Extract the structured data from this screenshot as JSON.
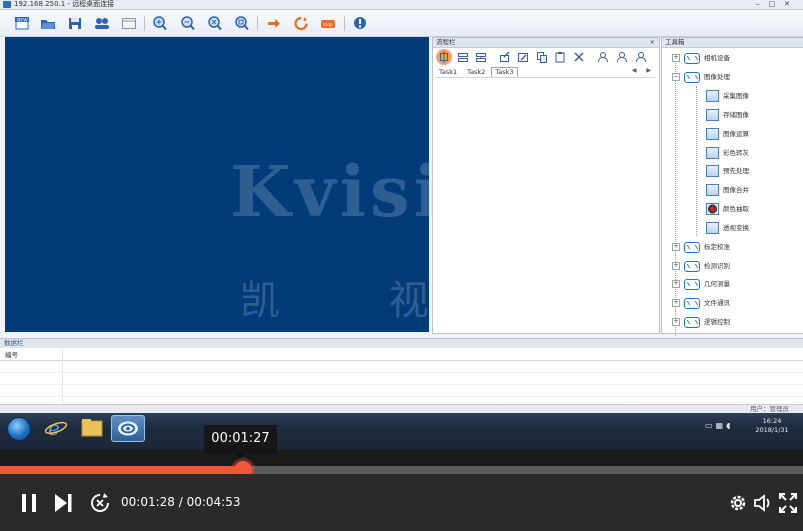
{
  "window": {
    "title": "192.168.250.1 - 远程桌面连接"
  },
  "canvas": {
    "watermark": "Kvision",
    "watermark_cn": "凯 视 觉"
  },
  "flow_panel": {
    "title": "流程栏",
    "close": "×",
    "tabs": [
      "Task1",
      "Task2",
      "Task3"
    ],
    "nav": "◀ ▶"
  },
  "tool_panel": {
    "title": "工具箱",
    "categories": [
      {
        "label": "相机设备",
        "expander": "+"
      },
      {
        "label": "图像处理",
        "expander": "−",
        "children": [
          "采集图像",
          "存储图像",
          "图像运算",
          "彩色转灰",
          "预先处理",
          "图像合并",
          "颜色抽取",
          "透视变换"
        ]
      },
      {
        "label": "标定校准",
        "expander": "+"
      },
      {
        "label": "检测识别",
        "expander": "+"
      },
      {
        "label": "几何测量",
        "expander": "+"
      },
      {
        "label": "文件通讯",
        "expander": "+"
      },
      {
        "label": "逻辑控制",
        "expander": "+"
      }
    ]
  },
  "data_panel": {
    "title": "数据栏",
    "column": "编号"
  },
  "statusbar": {
    "text": "用户：管理员"
  },
  "taskbar": {
    "time": "16:24",
    "date": "2018/1/31"
  },
  "player": {
    "hover_time": "00:01:27",
    "current_time": "00:01:28",
    "total_time": "00:04:53",
    "time_separator": " / ",
    "progress": 0.302,
    "accent": "#f2573a"
  }
}
